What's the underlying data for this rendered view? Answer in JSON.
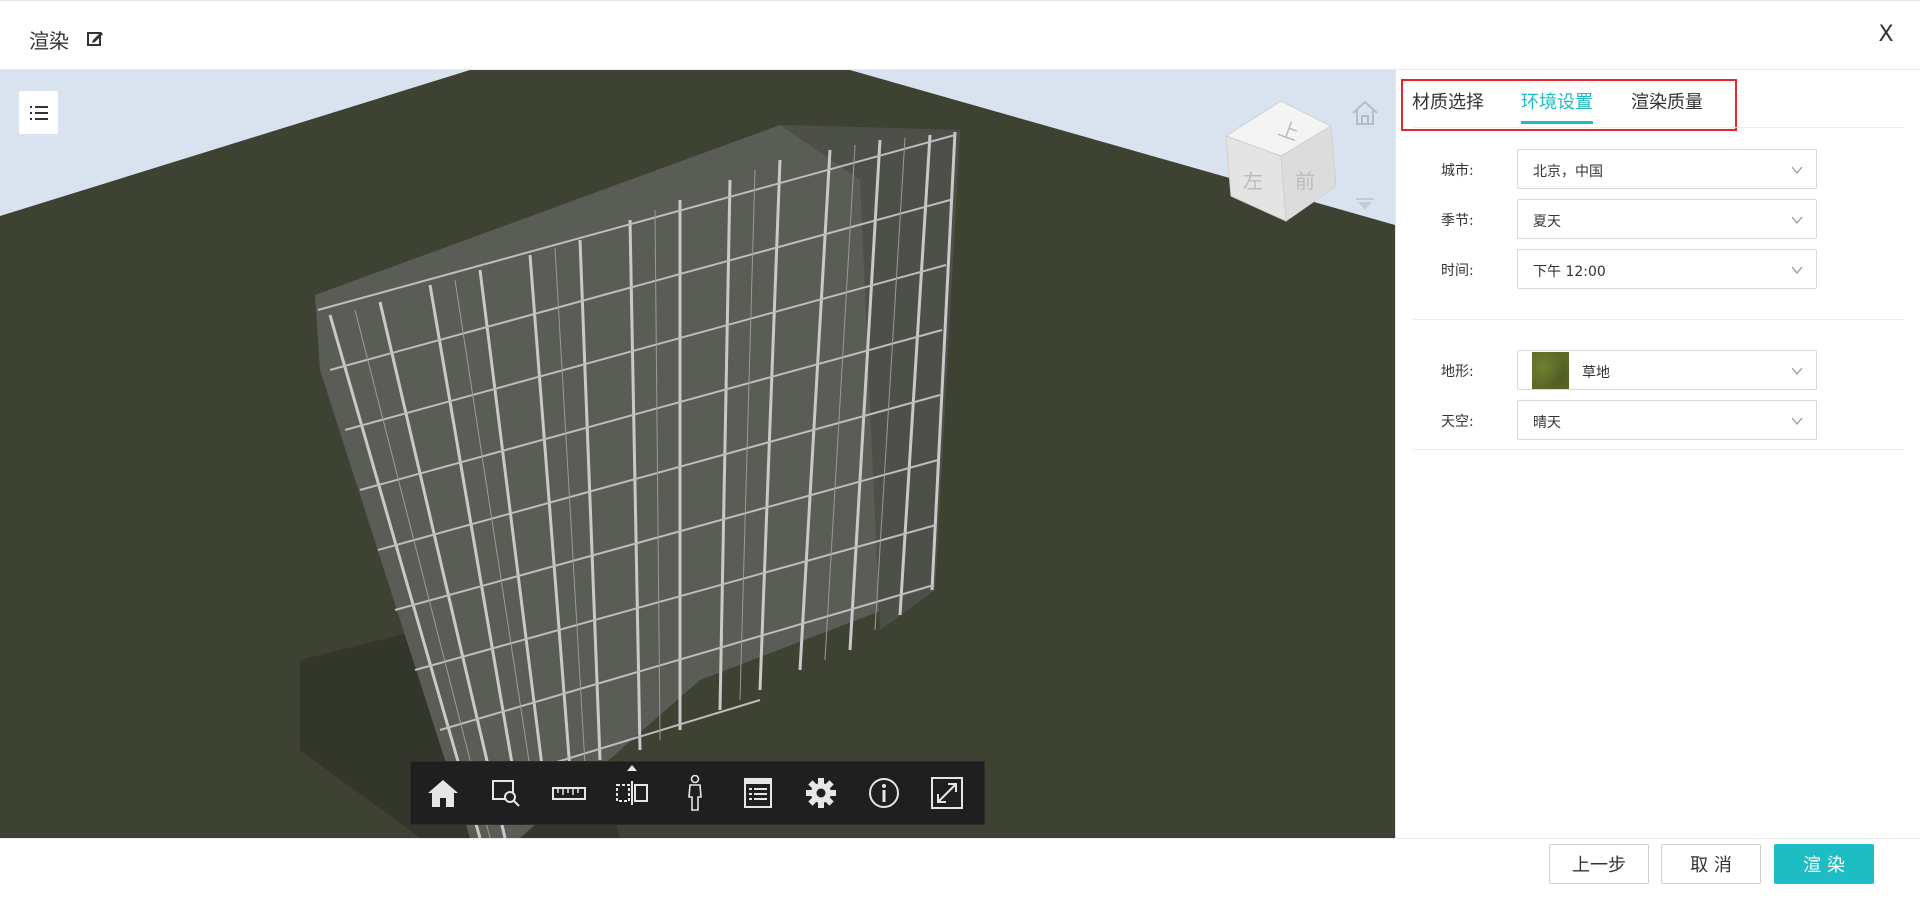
{
  "header": {
    "title": "渲染",
    "close_label": "X"
  },
  "viewer": {
    "viewcube": {
      "top": "上",
      "left": "左",
      "front": "前"
    },
    "toolbar": [
      {
        "name": "home-icon"
      },
      {
        "name": "zoom-window-icon"
      },
      {
        "name": "measure-ruler-icon"
      },
      {
        "name": "section-icon"
      },
      {
        "name": "person-walk-icon"
      },
      {
        "name": "properties-list-icon"
      },
      {
        "name": "settings-gear-icon"
      },
      {
        "name": "info-icon"
      },
      {
        "name": "fullscreen-icon"
      }
    ],
    "colors": {
      "ground": "#3e4233",
      "sky": "#d9e3ef",
      "toolbar": "#1f1f1f"
    }
  },
  "panel": {
    "tabs": [
      {
        "label": "材质选择",
        "active": false
      },
      {
        "label": "环境设置",
        "active": true
      },
      {
        "label": "渲染质量",
        "active": false
      }
    ],
    "fields": {
      "city": {
        "label": "城市:",
        "value": "北京，中国"
      },
      "season": {
        "label": "季节:",
        "value": "夏天"
      },
      "time": {
        "label": "时间:",
        "value": "下午 12:00"
      },
      "terrain": {
        "label": "地形:",
        "value": "草地"
      },
      "sky": {
        "label": "天空:",
        "value": "晴天"
      }
    },
    "accent_color": "#1ebdc4"
  },
  "footer": {
    "prev_label": "上一步",
    "cancel_label": "取 消",
    "render_label": "渲 染"
  }
}
